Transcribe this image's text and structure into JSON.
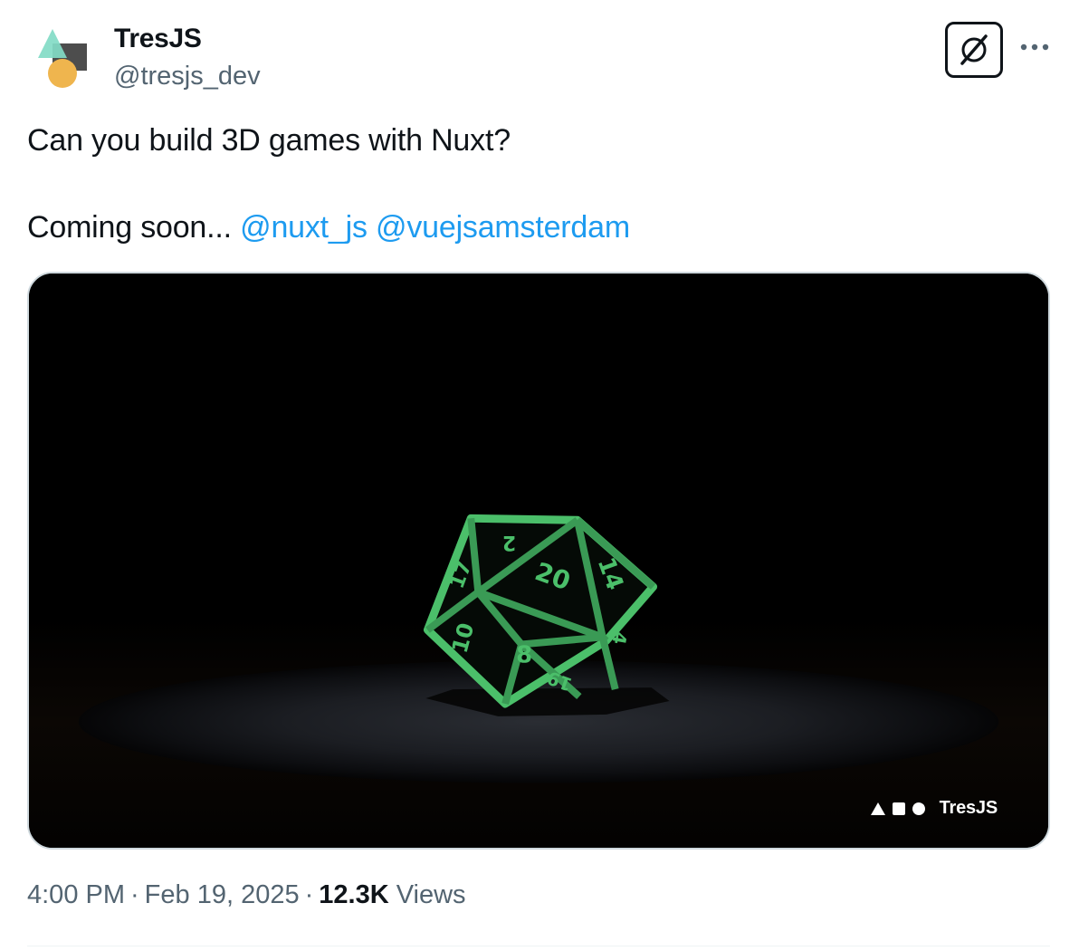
{
  "author": {
    "name": "TresJS",
    "handle": "@tresjs_dev"
  },
  "tweet": {
    "line1": "Can you build 3D games with Nuxt?",
    "line2_prefix": "Coming soon...",
    "mentions": [
      "@nuxt_js",
      "@vuejsamsterdam"
    ]
  },
  "media": {
    "watermark_text": "TresJS",
    "die_numbers": [
      "2",
      "20",
      "14",
      "17",
      "10",
      "8",
      "19",
      "4"
    ]
  },
  "meta": {
    "time": "4:00 PM",
    "date": "Feb 19, 2025",
    "views_count": "12.3K",
    "views_label": "Views"
  },
  "icons": {
    "grok": "grok-icon",
    "more": "more-dots-icon"
  },
  "colors": {
    "link": "#1d9bf0",
    "secondary_text": "#536471",
    "die_green": "#4bbf6a",
    "avatar_teal": "#82dbc5",
    "avatar_dark": "#4d4d4d",
    "avatar_orange": "#efb54e"
  }
}
